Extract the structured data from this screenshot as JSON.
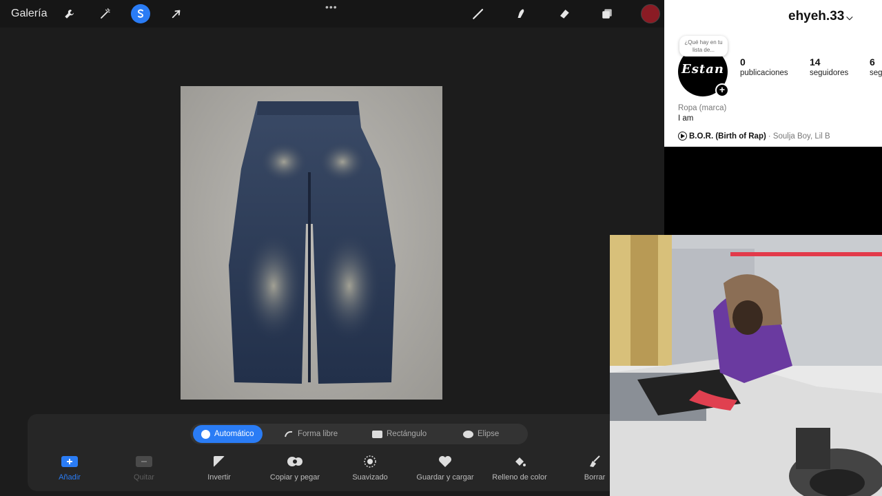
{
  "procreate": {
    "gallery_label": "Galería",
    "colors": {
      "accent": "#2a7cf5",
      "color_swatch": "#8a1b24"
    },
    "top_icons": [
      "wrench-icon",
      "magic-wand-icon",
      "selection-s-icon",
      "arrow-icon"
    ],
    "right_icons": [
      "brush-icon",
      "smudge-icon",
      "eraser-icon",
      "layers-icon",
      "color-icon"
    ],
    "selection_modes": [
      {
        "label": "Automático",
        "active": true
      },
      {
        "label": "Forma libre",
        "active": false
      },
      {
        "label": "Rectángulo",
        "active": false
      },
      {
        "label": "Elipse",
        "active": false
      }
    ],
    "tools": [
      {
        "label": "Añadir",
        "enabled": true
      },
      {
        "label": "Quitar",
        "enabled": false
      },
      {
        "label": "Invertir",
        "enabled": true
      },
      {
        "label": "Copiar y pegar",
        "enabled": true
      },
      {
        "label": "Suavizado",
        "enabled": true
      },
      {
        "label": "Guardar y cargar",
        "enabled": true
      },
      {
        "label": "Relleno de color",
        "enabled": true
      },
      {
        "label": "Borrar",
        "enabled": true
      }
    ]
  },
  "instagram": {
    "username": "ehyeh.33",
    "note": "¿Qué hay en tu lista de...",
    "avatar_text": "Estan",
    "stats": [
      {
        "count": "0",
        "label": "publicaciones"
      },
      {
        "count": "14",
        "label": "seguidores"
      },
      {
        "count": "6",
        "label": "seguidos"
      }
    ],
    "category": "Ropa (marca)",
    "bio": "I am",
    "song": "B.O.R. (Birth of Rap)",
    "artist": "· Soulja Boy, Lil B"
  }
}
